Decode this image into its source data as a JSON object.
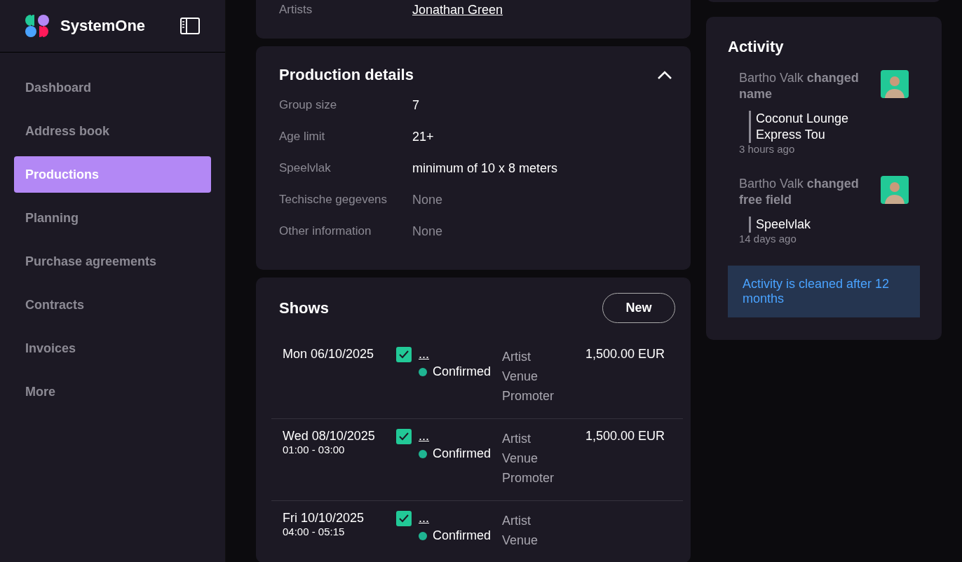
{
  "brand": {
    "name": "SystemOne"
  },
  "sidebar": {
    "items": [
      {
        "label": "Dashboard",
        "selected": false
      },
      {
        "label": "Address book",
        "selected": false
      },
      {
        "label": "Productions",
        "selected": true
      },
      {
        "label": "Planning",
        "selected": false
      },
      {
        "label": "Purchase agreements",
        "selected": false
      },
      {
        "label": "Contracts",
        "selected": false
      },
      {
        "label": "Invoices",
        "selected": false
      },
      {
        "label": "More",
        "selected": false
      }
    ]
  },
  "general": {
    "rows": [
      {
        "label": "Artists",
        "value": "Jonathan Green"
      }
    ]
  },
  "production_details": {
    "title": "Production details",
    "expanded": true,
    "rows": [
      {
        "label": "Group size",
        "value": "7",
        "kind": "text"
      },
      {
        "label": "Age limit",
        "value": "21+",
        "kind": "text"
      },
      {
        "label": "Speelvlak",
        "value": "minimum of 10 x 8 meters",
        "kind": "text"
      },
      {
        "label": "Techische gegevens",
        "value": "None",
        "kind": "empty"
      },
      {
        "label": "Other information",
        "value": "None",
        "kind": "empty"
      }
    ]
  },
  "shows": {
    "title": "Shows",
    "new_button": "New",
    "rows": [
      {
        "date": "Mon 06/10/2025",
        "checked": true,
        "link": "...",
        "status": "Confirmed",
        "color": "#1fb592",
        "parties": [
          "Artist",
          "Venue",
          "Promoter"
        ],
        "amount": "1,500.00 EUR"
      },
      {
        "date": "Wed 08/10/2025",
        "time": "01:00 - 03:00",
        "checked": true,
        "link": "...",
        "status": "Confirmed",
        "color": "#1fb592",
        "parties": [
          "Artist",
          "Venue",
          "Promoter"
        ],
        "amount": "1,500.00 EUR"
      },
      {
        "date": "Fri 10/10/2025",
        "time": "04:00 - 05:15",
        "checked": true,
        "link": "...",
        "status": "Confirmed",
        "color": "#1fb592",
        "parties": [
          "Artist",
          "Venue"
        ]
      }
    ]
  },
  "activity": {
    "title": "Activity",
    "items": [
      {
        "text": "Bartho Valk **changed name**",
        "detail": "Coconut Lounge Express Tou",
        "time": "3 hours ago"
      },
      {
        "text": "Bartho Valk **changed free field**",
        "detail": "Speelvlak",
        "time": "14 days ago"
      }
    ],
    "notice": "Activity is cleaned after 12 months"
  }
}
